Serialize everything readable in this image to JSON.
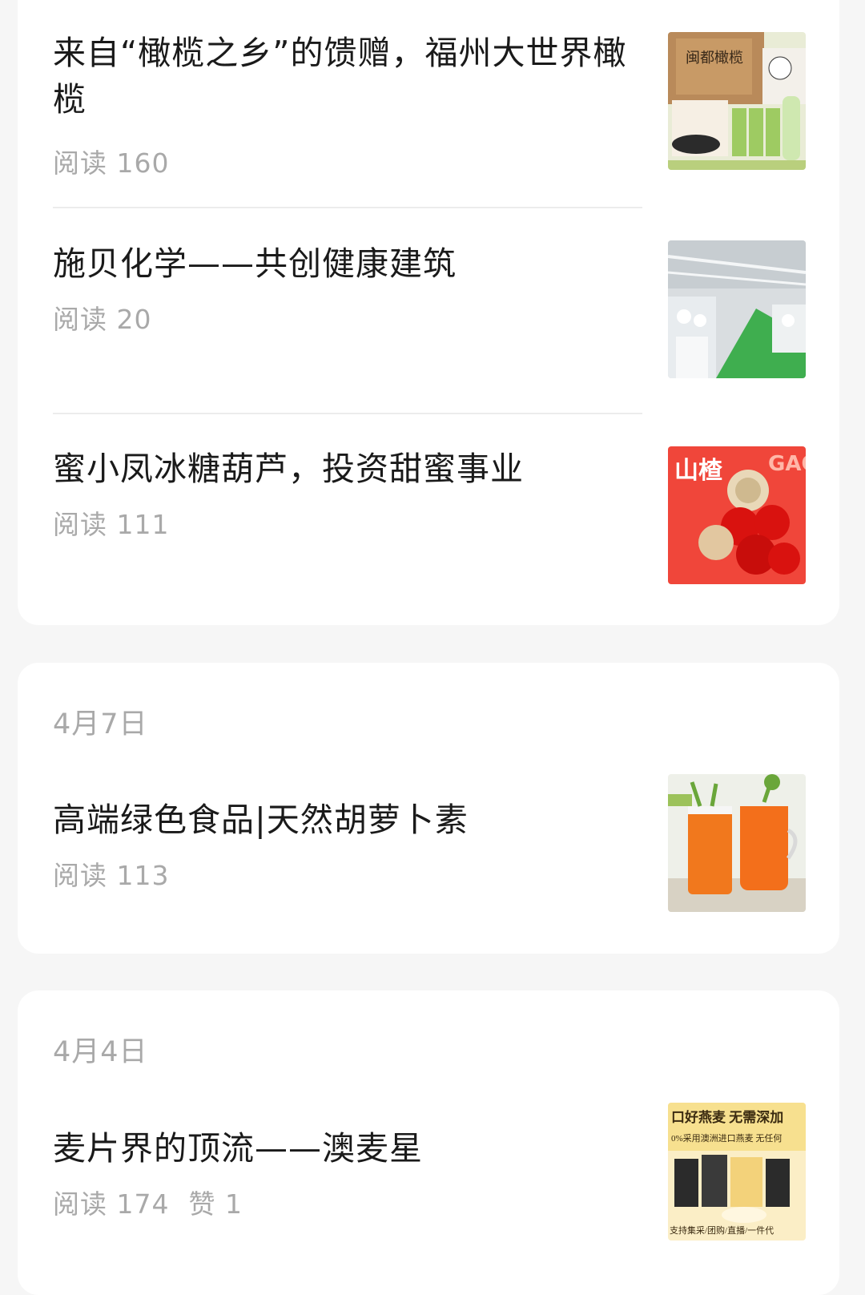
{
  "groups": [
    {
      "date": "",
      "articles": [
        {
          "title": "来自“橄榄之乡”的馈赠，福州大世界橄榄",
          "reads": "阅读 160",
          "likes": "",
          "thumb_icon": "olive-products-image"
        },
        {
          "title": "施贝化学——共创健康建筑",
          "reads": "阅读 20",
          "likes": "",
          "thumb_icon": "factory-workshop-image"
        },
        {
          "title": "蜜小凤冰糖葫芦，投资甜蜜事业",
          "reads": "阅读 111",
          "likes": "",
          "thumb_icon": "candied-haws-image"
        }
      ]
    },
    {
      "date": "4月7日",
      "articles": [
        {
          "title": "高端绿色食品|天然胡萝卜素",
          "reads": "阅读 113",
          "likes": "",
          "thumb_icon": "carrot-juice-image"
        }
      ]
    },
    {
      "date": "4月4日",
      "articles": [
        {
          "title": "麦片界的顶流——澳麦星",
          "reads": "阅读 174",
          "likes": "赞 1",
          "thumb_icon": "oatmeal-ad-image"
        }
      ]
    }
  ],
  "thumb_texts": {
    "olive_brand": "闽都橄榄",
    "candied_label_cn": "山楂",
    "candied_label_en": "GAO",
    "oat_line1": "口好燕麦 无需深加",
    "oat_line2": "0%采用澳洲进口燕麦 无任何",
    "oat_line3": "支持集采/团购/直播/一件代"
  },
  "colors": {
    "background": "#f6f6f6",
    "card": "#ffffff",
    "title": "#1a1a1a",
    "meta": "#a9a9a9",
    "divider": "#ececec"
  }
}
